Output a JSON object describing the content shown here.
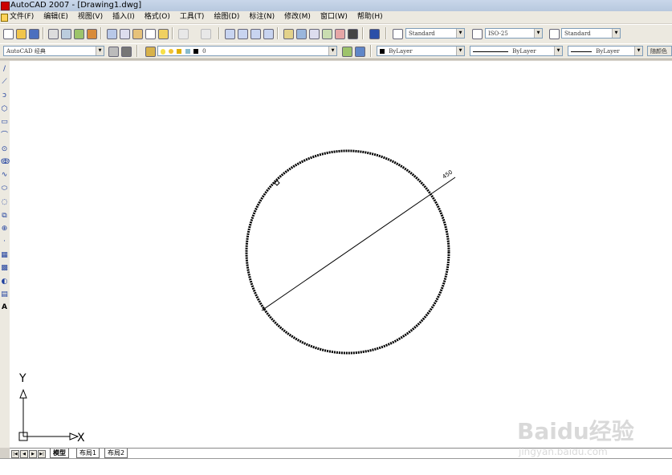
{
  "window": {
    "title": "AutoCAD 2007 - [Drawing1.dwg]"
  },
  "menu": [
    "文件(F)",
    "编辑(E)",
    "视图(V)",
    "插入(I)",
    "格式(O)",
    "工具(T)",
    "绘图(D)",
    "标注(N)",
    "修改(M)",
    "窗口(W)",
    "帮助(H)"
  ],
  "toolbar": {
    "text_style": "Standard",
    "dim_style": "ISO-25",
    "table_style": "Standard",
    "workspace": "AutoCAD 经典",
    "layer": "0",
    "color": "ByLayer",
    "linetype": "ByLayer",
    "lineweight": "ByLayer",
    "plot_style": "随颜色"
  },
  "drawing": {
    "dimension_text": "450",
    "ucs_x": "X",
    "ucs_y": "Y"
  },
  "layout_tabs": [
    "模型",
    "布局1",
    "布局2"
  ],
  "watermark": {
    "brand": "Baidu经验",
    "url": "jingyan.baidu.com"
  },
  "icons": [
    "app-icon",
    "new-icon",
    "open-icon",
    "save-icon",
    "print-icon",
    "zoom-icon",
    "layer-icon",
    "undo-icon",
    "redo-icon",
    "help-icon",
    "line-icon",
    "circle-icon",
    "arc-icon",
    "text-icon"
  ]
}
